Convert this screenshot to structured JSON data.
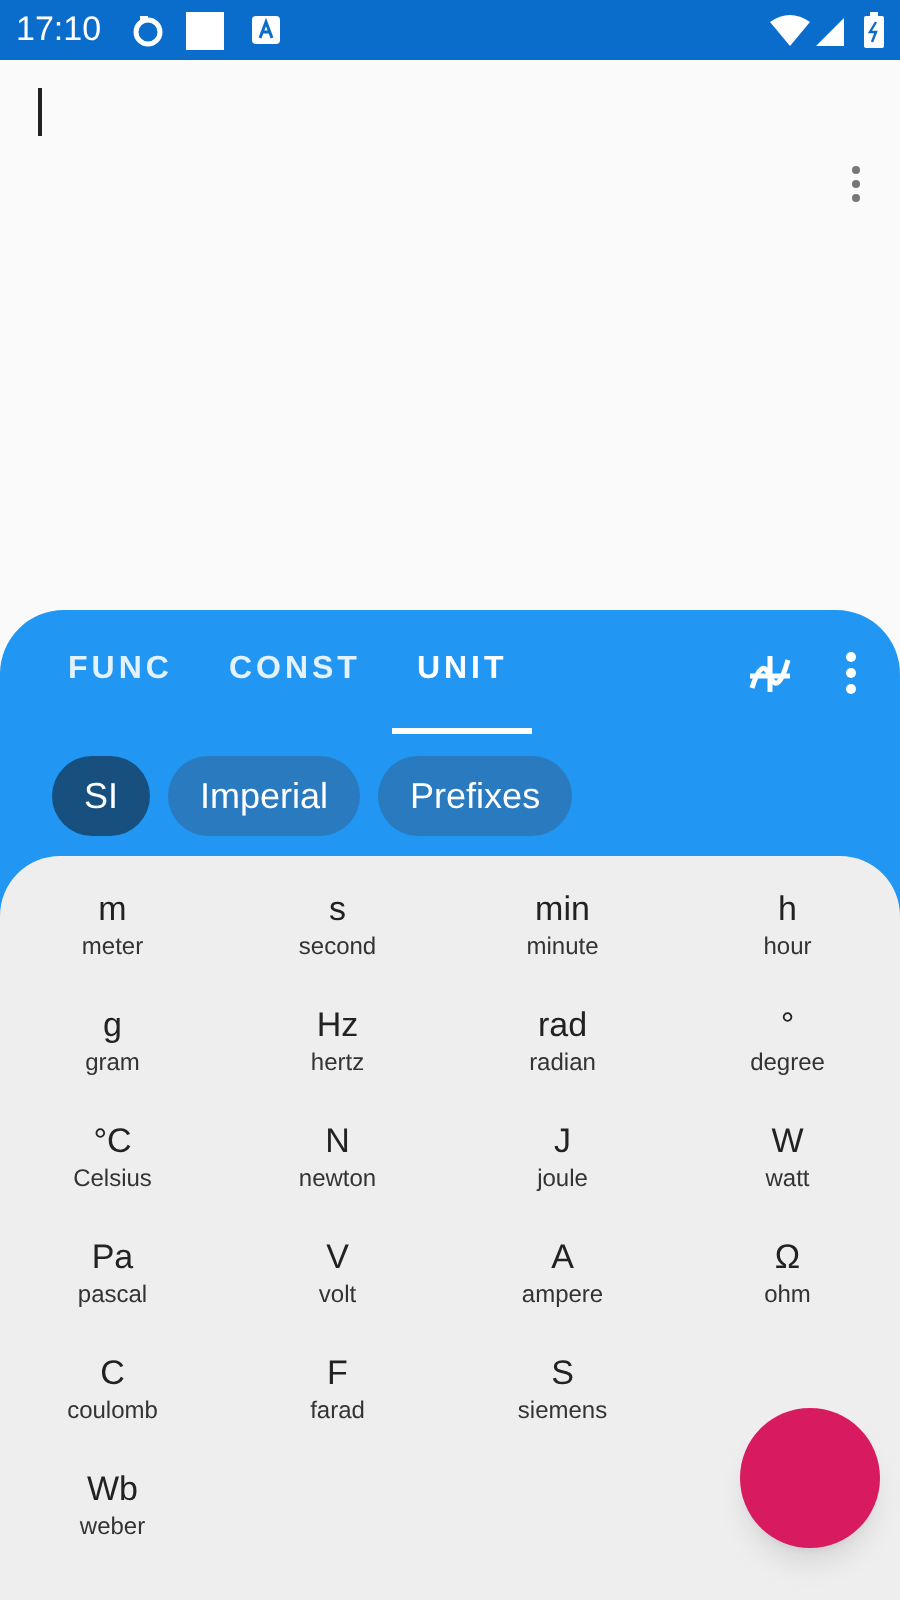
{
  "status_bar": {
    "time": "17:10"
  },
  "tabs": [
    {
      "label": "FUNC",
      "selected": false
    },
    {
      "label": "CONST",
      "selected": false
    },
    {
      "label": "UNIT",
      "selected": true
    }
  ],
  "chips": [
    {
      "label": "SI",
      "selected": true
    },
    {
      "label": "Imperial",
      "selected": false
    },
    {
      "label": "Prefixes",
      "selected": false
    }
  ],
  "unit_rows": [
    [
      {
        "symbol": "m",
        "name": "meter"
      },
      {
        "symbol": "s",
        "name": "second"
      },
      {
        "symbol": "min",
        "name": "minute"
      },
      {
        "symbol": "h",
        "name": "hour"
      }
    ],
    [
      {
        "symbol": "g",
        "name": "gram"
      },
      {
        "symbol": "Hz",
        "name": "hertz"
      },
      {
        "symbol": "rad",
        "name": "radian"
      },
      {
        "symbol": "°",
        "name": "degree"
      }
    ],
    [
      {
        "symbol": "°C",
        "name": "Celsius"
      },
      {
        "symbol": "N",
        "name": "newton"
      },
      {
        "symbol": "J",
        "name": "joule"
      },
      {
        "symbol": "W",
        "name": "watt"
      }
    ],
    [
      {
        "symbol": "Pa",
        "name": "pascal"
      },
      {
        "symbol": "V",
        "name": "volt"
      },
      {
        "symbol": "A",
        "name": "ampere"
      },
      {
        "symbol": "Ω",
        "name": "ohm"
      }
    ],
    [
      {
        "symbol": "C",
        "name": "coulomb"
      },
      {
        "symbol": "F",
        "name": "farad"
      },
      {
        "symbol": "S",
        "name": "siemens"
      }
    ],
    [
      {
        "symbol": "Wb",
        "name": "weber"
      }
    ]
  ]
}
